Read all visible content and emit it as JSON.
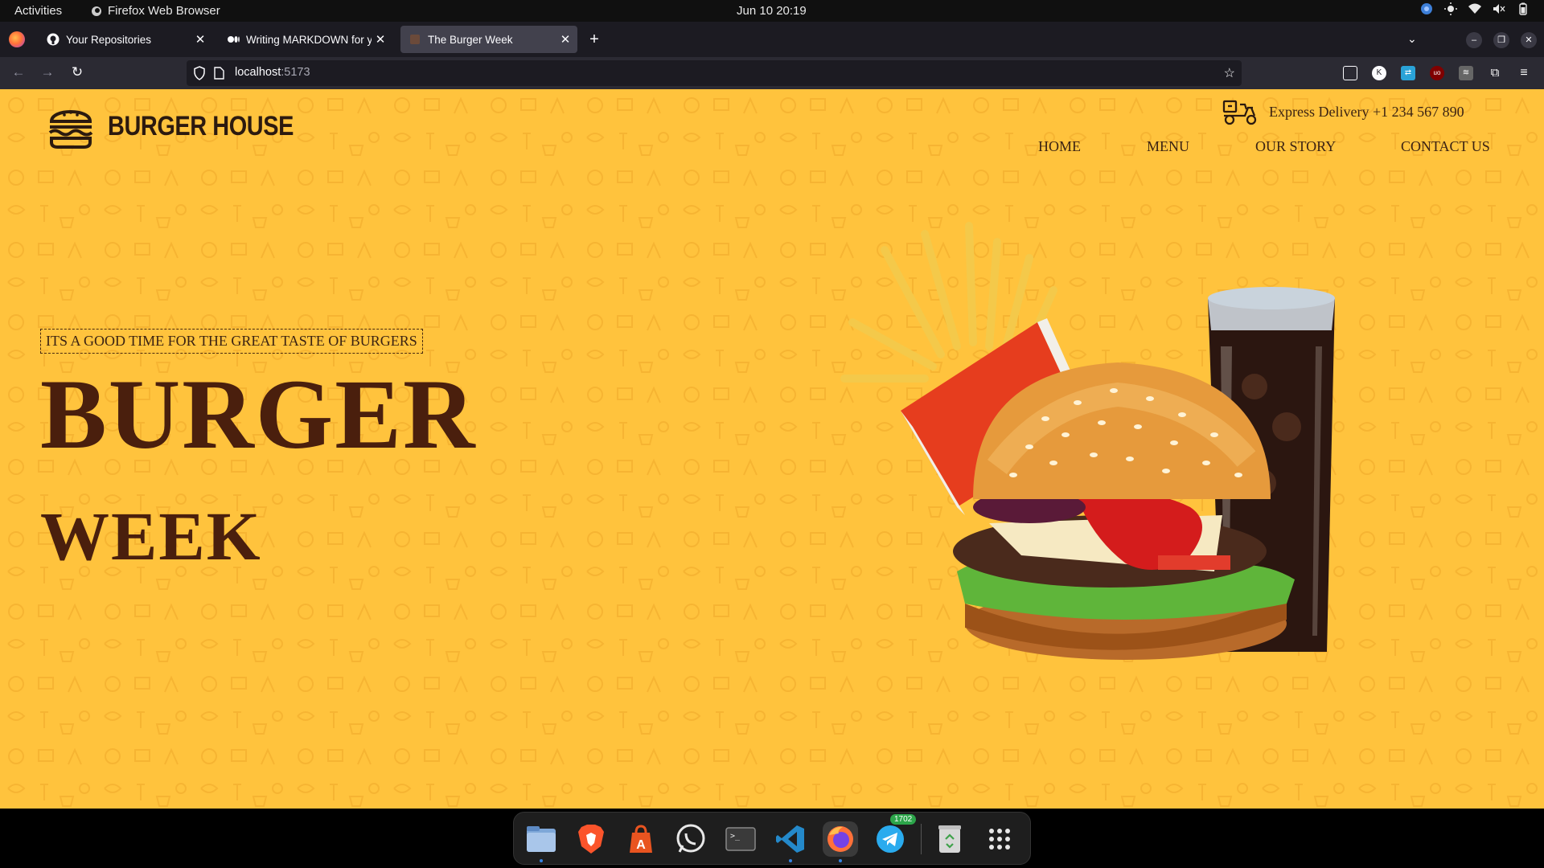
{
  "system": {
    "activities": "Activities",
    "app_name": "Firefox Web Browser",
    "clock": "Jun 10  20:19"
  },
  "browser": {
    "tabs": [
      {
        "title": "Your Repositories",
        "favicon": "github-icon",
        "active": false
      },
      {
        "title": "Writing MARKDOWN for y",
        "favicon": "medium-icon",
        "active": false
      },
      {
        "title": "The Burger Week",
        "favicon": "page-icon",
        "active": true
      }
    ],
    "url_host": "localhost",
    "url_port": ":5173"
  },
  "site": {
    "brand": "BURGER HOUSE",
    "delivery": "Express Delivery +1 234 567 890",
    "nav": [
      "HOME",
      "MENU",
      "OUR STORY",
      "CONTACT US"
    ],
    "tagline": "ITS A GOOD TIME FOR THE GREAT TASTE OF BURGERS",
    "hero_title": "BURGER",
    "hero_subtitle": "WEEK"
  },
  "dock": {
    "items": [
      "files-icon",
      "brave-icon",
      "app-center-icon",
      "whatsapp-icon",
      "terminal-icon",
      "vscode-icon",
      "firefox-icon",
      "telegram-icon",
      "trash-icon",
      "app-grid-icon"
    ],
    "telegram_badge": "1702"
  },
  "colors": {
    "background": "#ffc33d",
    "hero_text": "#4a1f0d",
    "nav_text": "#3b2313"
  }
}
